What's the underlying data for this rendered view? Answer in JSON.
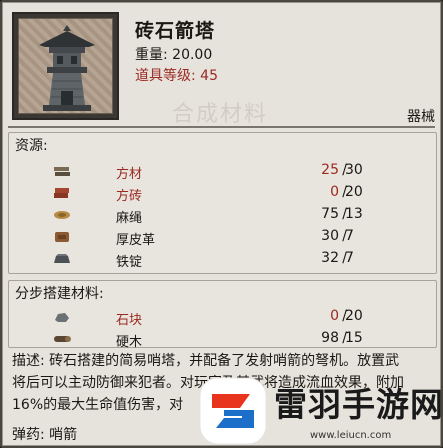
{
  "item": {
    "name": "砖石箭塔",
    "weight_label": "重量: 20.00",
    "level_label": "道具等级: 45",
    "category": "器械",
    "ghost_text": "合成材料"
  },
  "resources": {
    "title": "资源:",
    "rows": [
      {
        "icon": "planks-icon",
        "name": "方材",
        "have": "25",
        "need": "30",
        "sufficient": false
      },
      {
        "icon": "brick-icon",
        "name": "方砖",
        "have": "0",
        "need": "20",
        "sufficient": false
      },
      {
        "icon": "rope-icon",
        "name": "麻绳",
        "have": "75",
        "need": "13",
        "sufficient": true
      },
      {
        "icon": "leather-icon",
        "name": "厚皮革",
        "have": "30",
        "need": "7",
        "sufficient": true
      },
      {
        "icon": "ingot-icon",
        "name": "铁锭",
        "have": "32",
        "need": "7",
        "sufficient": true
      }
    ]
  },
  "stage_materials": {
    "title": "分步搭建材料:",
    "rows": [
      {
        "icon": "stone-icon",
        "name": "石块",
        "have": "0",
        "need": "20",
        "sufficient": false
      },
      {
        "icon": "hardwood-icon",
        "name": "硬木",
        "have": "98",
        "need": "15",
        "sufficient": true
      }
    ]
  },
  "description": {
    "line1": "描述: 砖石搭建的简易哨塔，并配备了发射哨箭的弩机。放置武",
    "line2": "将后可以主动防御来犯者。对玩家及其武将造成流血效果，附加",
    "line3": "16%的最大生命值伤害，对"
  },
  "ammo": "弹药: 哨箭",
  "watermark": {
    "text": "雷羽手游网",
    "url": "www.leiucn.com"
  },
  "colors": {
    "panel_bg": "#e6e3dc",
    "insufficient": "#9b2a22",
    "normal_text": "#1b1713"
  }
}
